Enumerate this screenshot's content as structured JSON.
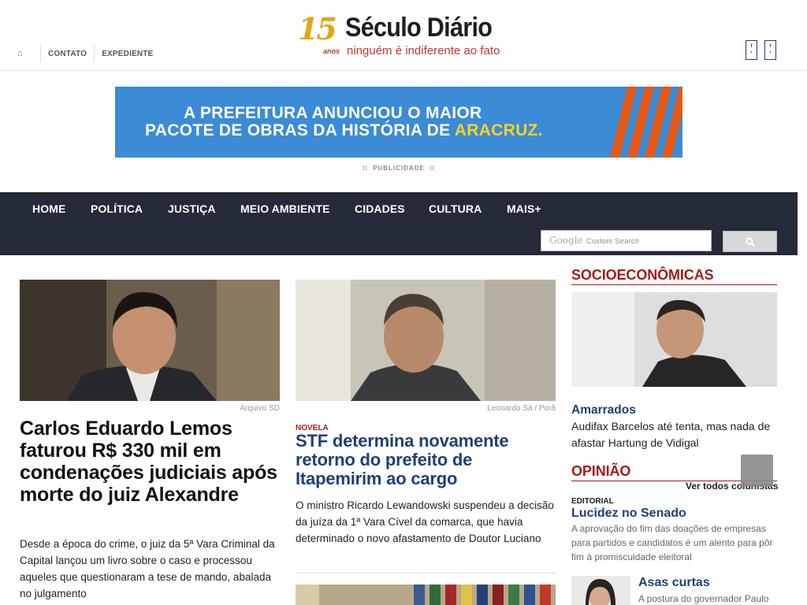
{
  "topbar": {
    "home_icon": "home-icon",
    "links": [
      "CONTATO",
      "EXPEDIENTE"
    ]
  },
  "logo": {
    "number": "15",
    "anos": "anos",
    "name": "Século Diário",
    "slogan": "ninguém é indiferente ao fato"
  },
  "social": {
    "icons": [
      "facebook-icon",
      "facebook-icon"
    ]
  },
  "banner": {
    "line1": "A PREFEITURA ANUNCIOU O MAIOR",
    "line2_prefix": "PACOTE DE OBRAS DA HISTÓRIA DE ",
    "line2_highlight": "ARACRUZ.",
    "colors": {
      "background": "#3b8bd6",
      "stripes": "#e65a16",
      "highlight": "#ffd320"
    }
  },
  "publicidade": "PUBLICIDADE",
  "nav": {
    "items": [
      "HOME",
      "POLÍTICA",
      "JUSTIÇA",
      "MEIO AMBIENTE",
      "CIDADES",
      "CULTURA",
      "MAIS+"
    ],
    "search_brand": "Google",
    "search_placeholder": "Custom Search",
    "search_icon": "search-icon",
    "background": "#252a38"
  },
  "main_left": {
    "photo_caption": "Arquivo SD",
    "headline": "Carlos Eduardo Lemos faturou R$ 330 mil em condenações judiciais após morte do juiz Alexandre",
    "summary": "Desde a época do crime, o juiz da 5ª Vara Criminal da Capital lançou um livro sobre o caso e processou aqueles que questionaram a tese de mando, abalada no julgamento"
  },
  "main_center": {
    "photo_caption": "Leonardo Sá / Porã",
    "kicker": "NOVELA",
    "headline": "STF determina novamente retorno do prefeito de Itapemirim ao cargo",
    "summary": "O ministro Ricardo Lewandowski suspendeu a decisão da juíza da 1ª Vara Cível da comarca, que havia determinado o novo afastamento de Doutor Luciano"
  },
  "sidebar": {
    "section1_title": "SOCIOECONÔMICAS",
    "story1_title": "Amarrados",
    "story1_summary": "Audifax Barcelos até tenta, mas nada de afastar Hartung de Vidigal",
    "section2_title": "OPINIÃO",
    "all_columnists": "Ver todos colunistas",
    "editorial_kicker": "EDITORIAL",
    "editorial_title": "Lucidez no Senado",
    "editorial_summary": "A aprovação do fim das doações de empresas para partidos e candidatos é um alento para pôr fim à promiscuidade eleitoral",
    "column_title": "Asas curtas",
    "column_summary": "A postura do governador Paulo",
    "back_to_top_icon": "arrow-up-icon"
  }
}
